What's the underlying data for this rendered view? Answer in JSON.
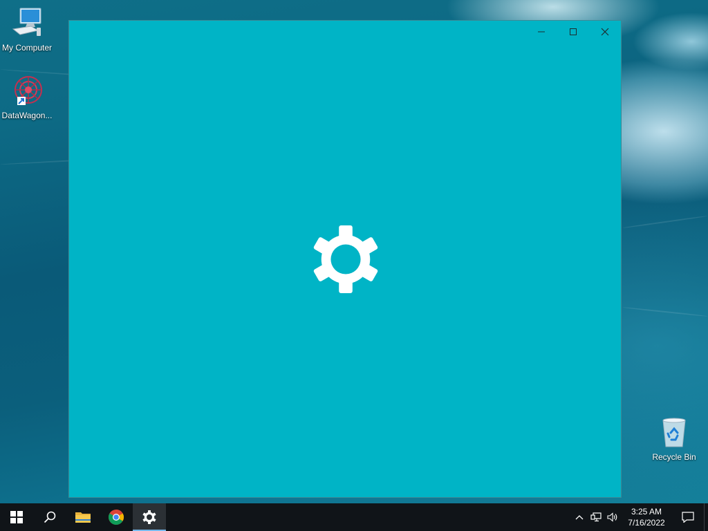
{
  "desktop": {
    "icons": [
      {
        "label": "My Computer",
        "icon": "computer-icon"
      },
      {
        "label": "DataWagon...",
        "icon": "datawagon-icon"
      },
      {
        "label": "Recycle Bin",
        "icon": "recycle-bin-icon"
      }
    ]
  },
  "window": {
    "app": "Settings",
    "background_color": "#00b4c6",
    "splash_icon": "gear-icon",
    "controls": {
      "minimize": "minimize-icon",
      "maximize": "maximize-icon",
      "close": "close-icon"
    }
  },
  "taskbar": {
    "items": [
      {
        "name": "start",
        "icon": "windows-logo-icon"
      },
      {
        "name": "search",
        "icon": "search-icon"
      },
      {
        "name": "file-explorer",
        "icon": "folder-icon"
      },
      {
        "name": "chrome",
        "icon": "chrome-icon"
      },
      {
        "name": "settings",
        "icon": "gear-icon",
        "active": true
      }
    ],
    "tray": {
      "icons": [
        "chevron-up-icon",
        "network-icon",
        "volume-icon"
      ],
      "time": "3:25 AM",
      "date": "7/16/2022",
      "notification_icon": "action-center-icon"
    },
    "accent_color": "#76b9ed"
  }
}
